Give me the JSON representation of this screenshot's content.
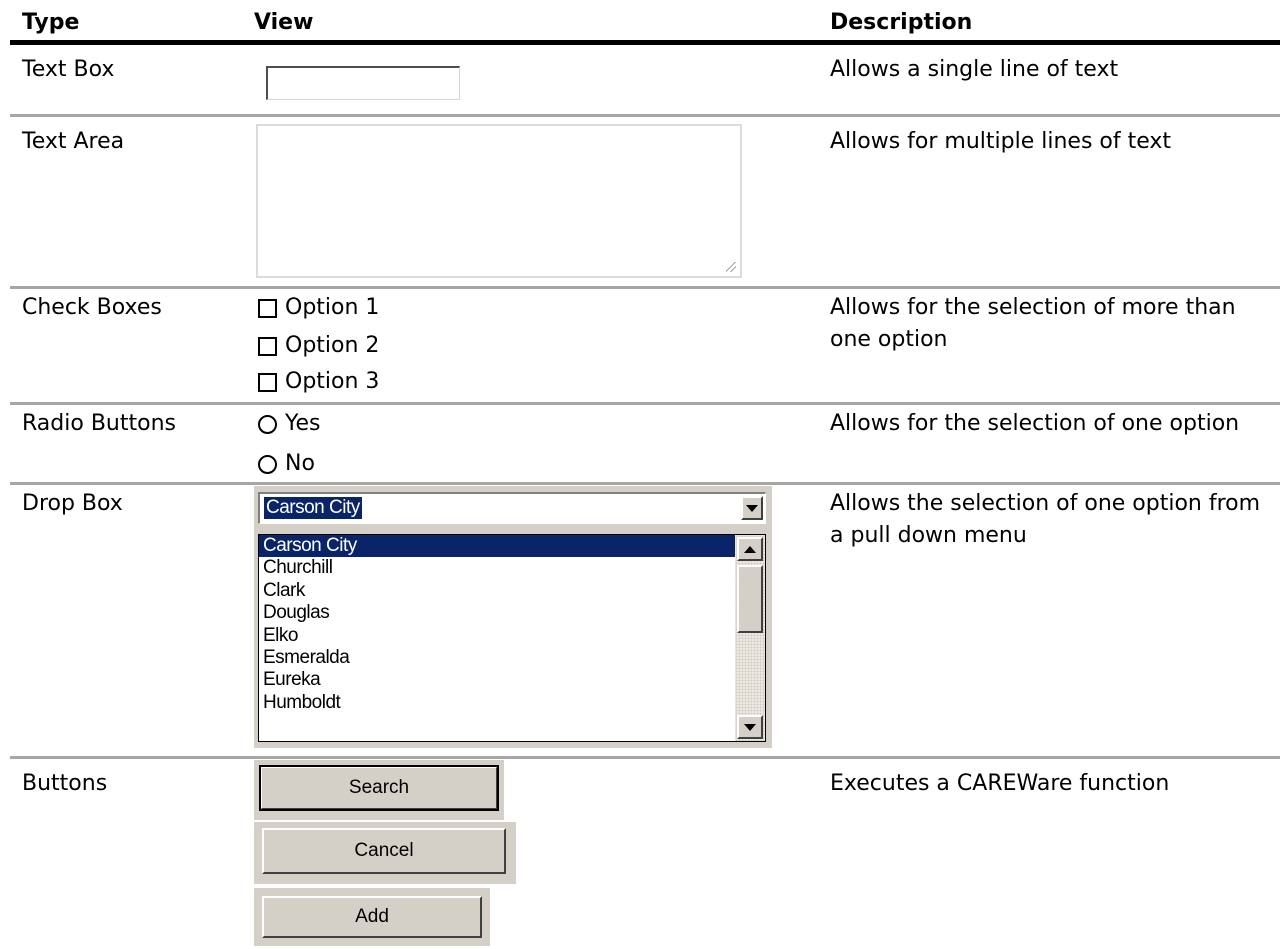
{
  "headers": {
    "type": "Type",
    "view": "View",
    "description": "Description"
  },
  "rows": {
    "text_box": {
      "type": "Text Box",
      "description": "Allows a single line of text"
    },
    "text_area": {
      "type": "Text Area",
      "description": "Allows for multiple lines of text"
    },
    "check_boxes": {
      "type": "Check Boxes",
      "description": "Allows for the selection of more than one option",
      "options": [
        "Option 1",
        "Option 2",
        "Option 3"
      ]
    },
    "radio_buttons": {
      "type": "Radio Buttons",
      "description": "Allows for the selection of one option",
      "options": [
        "Yes",
        "No"
      ]
    },
    "drop_box": {
      "type": "Drop Box",
      "description": "Allows the selection of one option from a pull down menu",
      "selected": "Carson City",
      "items": [
        "Carson City",
        "Churchill",
        "Clark",
        "Douglas",
        "Elko",
        "Esmeralda",
        "Eureka",
        "Humboldt"
      ]
    },
    "buttons": {
      "type": "Buttons",
      "description": "Executes a CAREWare function",
      "labels": [
        "Search",
        "Cancel",
        "Add"
      ]
    }
  },
  "colors": {
    "selection": "#0a246a",
    "control_face": "#d4d0c8",
    "row_separator": "#a6a6a6"
  }
}
